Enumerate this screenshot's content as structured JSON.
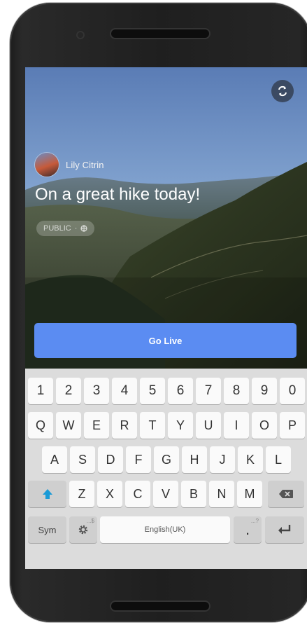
{
  "live": {
    "user_name": "Lily Citrin",
    "status": "On a great hike today!",
    "privacy": {
      "label": "PUBLIC",
      "separator": "·",
      "icon": "globe-icon"
    },
    "go_live_label": "Go Live",
    "switch_camera_icon": "switch-camera-icon"
  },
  "keyboard": {
    "number_row": [
      "1",
      "2",
      "3",
      "4",
      "5",
      "6",
      "7",
      "8",
      "9",
      "0"
    ],
    "row1": [
      "Q",
      "W",
      "E",
      "R",
      "T",
      "Y",
      "U",
      "I",
      "O",
      "P"
    ],
    "row2": [
      "A",
      "S",
      "D",
      "F",
      "G",
      "H",
      "J",
      "K",
      "L"
    ],
    "row3": [
      "Z",
      "X",
      "C",
      "V",
      "B",
      "N",
      "M"
    ],
    "shift_icon": "shift-arrow-icon",
    "backspace_icon": "backspace-icon",
    "sym_label": "Sym",
    "settings_hint": "...$",
    "settings_icon": "gear-icon",
    "space_label": "English(UK)",
    "period_label": ".",
    "period_hint": "...?",
    "enter_icon": "enter-icon"
  },
  "colors": {
    "accent": "#5b8cf2",
    "shift": "#1a9bd7"
  }
}
